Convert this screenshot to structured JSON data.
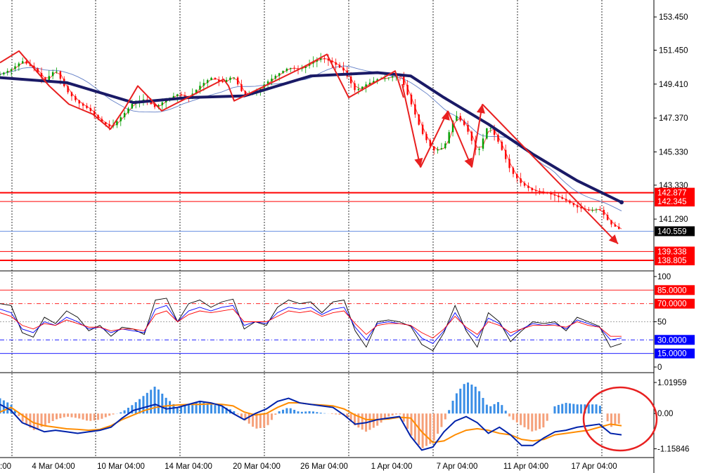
{
  "chart_data": [
    {
      "panel": "price",
      "type": "candlestick",
      "ylim": [
        138.3,
        154.3
      ],
      "y_ticks": [
        "153.450",
        "151.450",
        "149.410",
        "147.370",
        "145.330",
        "143.330",
        "141.290"
      ],
      "x_ticks": [
        "4 Mar 04:00",
        "10 Mar 04:00",
        "14 Mar 04:00",
        "20 Mar 04:00",
        "26 Mar 04:00",
        "1 Apr 04:00",
        "7 Apr 04:00",
        "11 Apr 04:00",
        "17 Apr 04:00"
      ],
      "x_tick_partial_left": ":00",
      "current_price": {
        "label": "140.559",
        "value": 140.559
      },
      "levels": [
        {
          "label": "142.877",
          "value": 142.877,
          "color": "#ff0000",
          "bold": true
        },
        {
          "label": "142.345",
          "value": 142.345,
          "color": "#ff0000",
          "bold": false
        },
        {
          "label": "139.338",
          "value": 139.338,
          "color": "#ff0000",
          "bold": false
        },
        {
          "label": "138.805",
          "value": 138.805,
          "color": "#ff0000",
          "bold": true
        }
      ],
      "close_path": [
        [
          0,
          150.0
        ],
        [
          1,
          150.3
        ],
        [
          2,
          150.8
        ],
        [
          3,
          150.4
        ],
        [
          4,
          149.6
        ],
        [
          5,
          150.3
        ],
        [
          6,
          149.0
        ],
        [
          7,
          148.3
        ],
        [
          8,
          147.9
        ],
        [
          9,
          147.2
        ],
        [
          10,
          146.8
        ],
        [
          11,
          147.5
        ],
        [
          12,
          148.3
        ],
        [
          13,
          148.5
        ],
        [
          14,
          148.0
        ],
        [
          15,
          148.5
        ],
        [
          16,
          148.8
        ],
        [
          17,
          148.6
        ],
        [
          18,
          149.3
        ],
        [
          19,
          149.8
        ],
        [
          20,
          149.5
        ],
        [
          21,
          149.9
        ],
        [
          22,
          148.7
        ],
        [
          23,
          148.9
        ],
        [
          24,
          149.5
        ],
        [
          25,
          150.0
        ],
        [
          26,
          150.4
        ],
        [
          27,
          150.3
        ],
        [
          28,
          150.7
        ],
        [
          29,
          151.0
        ],
        [
          30,
          150.7
        ],
        [
          31,
          150.2
        ],
        [
          32,
          149.0
        ],
        [
          33,
          149.4
        ],
        [
          34,
          149.7
        ],
        [
          35,
          149.8
        ],
        [
          36,
          150.0
        ],
        [
          37,
          148.3
        ],
        [
          38,
          146.5
        ],
        [
          39,
          145.4
        ],
        [
          40,
          145.6
        ],
        [
          41,
          147.6
        ],
        [
          42,
          146.8
        ],
        [
          43,
          145.2
        ],
        [
          44,
          147.0
        ],
        [
          45,
          145.8
        ],
        [
          46,
          144.2
        ],
        [
          47,
          143.4
        ],
        [
          48,
          143.0
        ],
        [
          49,
          142.9
        ],
        [
          50,
          142.7
        ],
        [
          51,
          142.4
        ],
        [
          52,
          142.0
        ],
        [
          53,
          141.8
        ],
        [
          54,
          141.9
        ],
        [
          55,
          141.0
        ],
        [
          56,
          140.6
        ]
      ],
      "moving_averages": "rainbow ribbon of 14 MAs plus a bold navy long-period MA",
      "long_ma": [
        [
          0,
          149.8
        ],
        [
          6,
          149.5
        ],
        [
          12,
          148.3
        ],
        [
          17,
          148.6
        ],
        [
          22,
          148.7
        ],
        [
          28,
          149.9
        ],
        [
          34,
          150.1
        ],
        [
          37,
          149.9
        ],
        [
          40,
          148.6
        ],
        [
          44,
          147.0
        ],
        [
          48,
          145.2
        ],
        [
          52,
          143.6
        ],
        [
          56,
          142.3
        ]
      ],
      "annotations": "red hand-drawn zigzag lines and arrows"
    },
    {
      "panel": "oscillator",
      "type": "line",
      "ylim": [
        0,
        100
      ],
      "y_ticks": [
        "100",
        "50",
        "0"
      ],
      "levels": [
        {
          "label": "85.0000",
          "value": 85,
          "color": "#ff0000",
          "style": "solid"
        },
        {
          "label": "70.0000",
          "value": 70,
          "color": "#ff0000",
          "style": "dashdot"
        },
        {
          "label": "30.0000",
          "value": 30,
          "color": "#0000ff",
          "style": "dashdot"
        },
        {
          "label": "15.0000",
          "value": 15,
          "color": "#0000ff",
          "style": "solid"
        }
      ],
      "series": [
        {
          "color": "#000000",
          "values": [
            70,
            68,
            38,
            33,
            55,
            48,
            62,
            55,
            40,
            46,
            34,
            44,
            42,
            36,
            74,
            76,
            50,
            70,
            74,
            66,
            72,
            75,
            42,
            50,
            46,
            66,
            74,
            70,
            72,
            60,
            72,
            74,
            40,
            22,
            50,
            52,
            50,
            45,
            25,
            18,
            38,
            68,
            40,
            22,
            60,
            50,
            28,
            40,
            50,
            48,
            50,
            40,
            55,
            50,
            45,
            22,
            26
          ]
        },
        {
          "color": "#0000ff",
          "values": [
            64,
            60,
            42,
            38,
            50,
            46,
            55,
            50,
            42,
            44,
            38,
            42,
            40,
            38,
            64,
            68,
            50,
            62,
            66,
            62,
            66,
            68,
            46,
            50,
            48,
            60,
            66,
            64,
            66,
            58,
            64,
            66,
            44,
            30,
            48,
            50,
            48,
            46,
            32,
            26,
            40,
            60,
            42,
            32,
            54,
            48,
            34,
            42,
            48,
            46,
            48,
            42,
            52,
            48,
            44,
            30,
            32
          ]
        },
        {
          "color": "#ff0000",
          "values": [
            60,
            56,
            46,
            42,
            48,
            46,
            52,
            48,
            44,
            44,
            40,
            42,
            42,
            40,
            58,
            62,
            50,
            58,
            62,
            60,
            62,
            64,
            50,
            50,
            50,
            56,
            62,
            60,
            62,
            56,
            60,
            62,
            48,
            36,
            46,
            48,
            48,
            46,
            38,
            32,
            42,
            56,
            44,
            36,
            50,
            46,
            38,
            42,
            46,
            46,
            46,
            44,
            50,
            46,
            44,
            34,
            34
          ]
        }
      ]
    },
    {
      "panel": "macd",
      "type": "bar+line",
      "ylim": [
        -1.4,
        1.25
      ],
      "y_ticks": [
        "1.01959",
        "0.00",
        "-1.15846"
      ],
      "histogram": [
        0.5,
        0.3,
        -0.25,
        -0.55,
        -0.4,
        -0.2,
        -0.1,
        -0.15,
        -0.25,
        -0.2,
        -0.05,
        0.05,
        0.3,
        0.6,
        0.9,
        0.5,
        0.2,
        0.3,
        0.4,
        0.3,
        0.25,
        0.1,
        -0.2,
        -0.5,
        -0.45,
        0.05,
        0.2,
        0.05,
        0.08,
        0.02,
        -0.02,
        -0.05,
        -0.4,
        -0.6,
        -0.4,
        -0.1,
        0.0,
        -0.7,
        -1.15,
        -0.95,
        -0.3,
        0.6,
        1.05,
        0.85,
        0.2,
        0.4,
        -0.15,
        -0.4,
        -0.6,
        -0.45,
        0.25,
        0.35,
        0.3,
        0.3,
        0.3,
        -0.45,
        -0.3
      ],
      "signal": [
        0.05,
        0.2,
        -0.05,
        -0.3,
        -0.4,
        -0.45,
        -0.5,
        -0.52,
        -0.55,
        -0.52,
        -0.4,
        -0.2,
        -0.05,
        0.1,
        0.2,
        0.25,
        0.28,
        0.3,
        0.3,
        0.32,
        0.3,
        0.25,
        0.05,
        -0.05,
        0.0,
        0.2,
        0.35,
        0.35,
        0.3,
        0.28,
        0.25,
        0.15,
        -0.05,
        -0.2,
        -0.2,
        -0.18,
        -0.12,
        -0.15,
        -0.6,
        -0.95,
        -0.9,
        -0.7,
        -0.55,
        -0.5,
        -0.55,
        -0.65,
        -0.7,
        -0.85,
        -0.9,
        -0.85,
        -0.7,
        -0.65,
        -0.6,
        -0.55,
        -0.45,
        -0.35,
        -0.4
      ],
      "macd": [
        0.3,
        0.1,
        -0.3,
        -0.45,
        -0.6,
        -0.55,
        -0.6,
        -0.65,
        -0.6,
        -0.55,
        -0.45,
        -0.15,
        0.1,
        0.2,
        0.3,
        0.15,
        0.2,
        0.3,
        0.4,
        0.35,
        0.25,
        0.0,
        -0.2,
        0.0,
        0.15,
        0.4,
        0.5,
        0.35,
        0.3,
        0.25,
        0.2,
        -0.05,
        -0.35,
        -0.3,
        -0.2,
        -0.15,
        -0.1,
        -0.75,
        -1.2,
        -1.1,
        -0.6,
        -0.25,
        -0.1,
        -0.3,
        -0.65,
        -0.45,
        -0.7,
        -1.05,
        -1.05,
        -0.8,
        -0.6,
        -0.55,
        -0.45,
        -0.4,
        -0.35,
        -0.65,
        -0.7
      ]
    }
  ],
  "colors": {
    "up": "#00a000",
    "down": "#ff0000",
    "navy": "#1a1a66",
    "hist_pos": "#3a8ee6",
    "hist_neg": "#f5a07a",
    "macd": "#0022aa",
    "signal": "#ff8c00",
    "annot": "#e82020"
  }
}
